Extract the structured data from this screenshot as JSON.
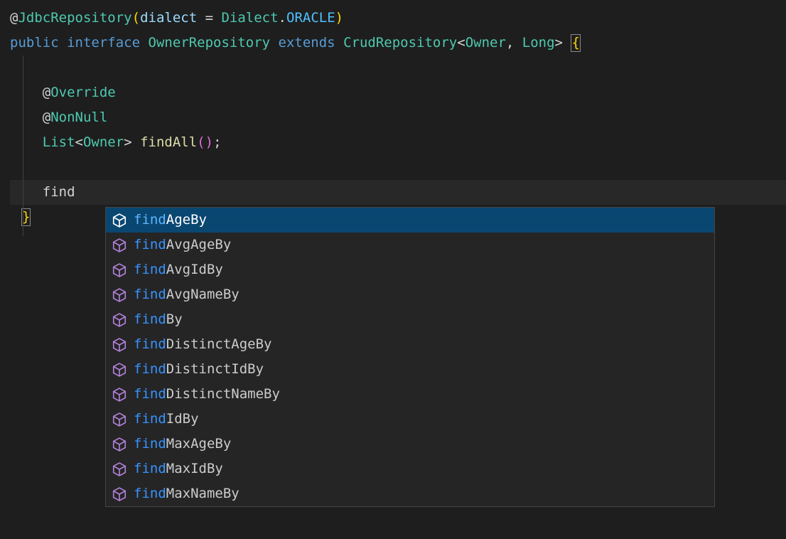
{
  "code": {
    "line1": {
      "at": "@",
      "annotation": "JdbcRepository",
      "lparen": "(",
      "param": "dialect",
      "eq": " = ",
      "type": "Dialect",
      "dot": ".",
      "enum": "ORACLE",
      "rparen": ")"
    },
    "line2": {
      "kw1": "public",
      "sp1": " ",
      "kw2": "interface",
      "sp2": " ",
      "cls1": "OwnerRepository",
      "sp3": " ",
      "kw3": "extends",
      "sp4": " ",
      "cls2": "CrudRepository",
      "lt": "<",
      "type1": "Owner",
      "comma": ", ",
      "type2": "Long",
      "gt": ">",
      "sp5": " ",
      "brace": "{"
    },
    "line4": {
      "indent": "    ",
      "at": "@",
      "annotation": "Override"
    },
    "line5": {
      "indent": "    ",
      "at": "@",
      "annotation": "NonNull"
    },
    "line6": {
      "indent": "    ",
      "type": "List",
      "lt": "<",
      "gtype": "Owner",
      "gt": ">",
      "sp": " ",
      "method": "findAll",
      "parens": "()",
      "semi": ";"
    },
    "line8": {
      "indent": "    ",
      "text": "find"
    },
    "closing_brace": "}"
  },
  "autocomplete": {
    "items": [
      {
        "match": "find",
        "rest": "AgeBy",
        "selected": true
      },
      {
        "match": "find",
        "rest": "AvgAgeBy",
        "selected": false
      },
      {
        "match": "find",
        "rest": "AvgIdBy",
        "selected": false
      },
      {
        "match": "find",
        "rest": "AvgNameBy",
        "selected": false
      },
      {
        "match": "find",
        "rest": "By",
        "selected": false
      },
      {
        "match": "find",
        "rest": "DistinctAgeBy",
        "selected": false
      },
      {
        "match": "find",
        "rest": "DistinctIdBy",
        "selected": false
      },
      {
        "match": "find",
        "rest": "DistinctNameBy",
        "selected": false
      },
      {
        "match": "find",
        "rest": "IdBy",
        "selected": false
      },
      {
        "match": "find",
        "rest": "MaxAgeBy",
        "selected": false
      },
      {
        "match": "find",
        "rest": "MaxIdBy",
        "selected": false
      },
      {
        "match": "find",
        "rest": "MaxNameBy",
        "selected": false
      }
    ]
  }
}
